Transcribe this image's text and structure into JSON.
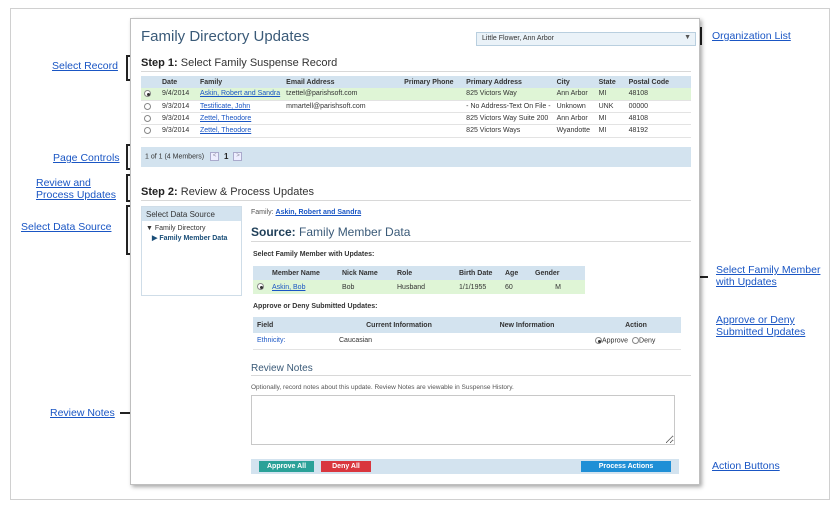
{
  "annotations": {
    "select_record": "Select Record",
    "page_controls": "Page Controls",
    "review_process_1": "Review and",
    "review_process_2": "Process Updates",
    "select_data_source": "Select Data Source",
    "review_notes": "Review Notes",
    "organization_list": "Organization List",
    "select_family_member_1": "Select Family Member",
    "select_family_member_2": "with Updates",
    "approve_deny_1": "Approve or Deny",
    "approve_deny_2": "Submitted Updates",
    "action_buttons": "Action Buttons"
  },
  "header": {
    "title": "Family Directory Updates",
    "organization_selected": "Little Flower, Ann Arbor"
  },
  "step1": {
    "label_bold": "Step 1:",
    "label_rest": " Select Family Suspense Record",
    "columns": [
      "Date",
      "Family",
      "Email Address",
      "Primary Phone",
      "Primary Address",
      "City",
      "State",
      "Postal Code"
    ],
    "rows": [
      {
        "date": "9/4/2014",
        "family": "Askin, Robert and Sandra",
        "email": "tzettel@parishsoft.com",
        "phone": "",
        "address": "825 Victors Way",
        "city": "Ann Arbor",
        "state": "MI",
        "postal": "48108"
      },
      {
        "date": "9/3/2014",
        "family": "Testificate, John",
        "email": "mmartell@parishsoft.com",
        "phone": "",
        "address": "- No Address-Text On File -",
        "city": "Unknown",
        "state": "UNK",
        "postal": "00000"
      },
      {
        "date": "9/3/2014",
        "family": "Zettel, Theodore",
        "email": "",
        "phone": "",
        "address": "825 Victors Way Suite 200",
        "city": "Ann Arbor",
        "state": "MI",
        "postal": "48108"
      },
      {
        "date": "9/3/2014",
        "family": "Zettel, Theodore",
        "email": "",
        "phone": "",
        "address": "825 Victors Ways",
        "city": "Wyandotte",
        "state": "MI",
        "postal": "48192"
      }
    ],
    "pager_text": "1 of 1 (4 Members)",
    "pager_prev": "<",
    "pager_page": "1",
    "pager_next": ">"
  },
  "step2": {
    "label_bold": "Step 2:",
    "label_rest": " Review & Process Updates",
    "data_source_header": "Select Data Source",
    "data_source_items": [
      "Family Directory",
      "Family Member Data"
    ],
    "family_label": "Family:",
    "family_name": "Askin, Robert and Sandra",
    "source_bold": "Source:",
    "source_rest": " Family Member Data",
    "select_member_label": "Select Family Member with Updates:",
    "member_columns": [
      "Member Name",
      "Nick Name",
      "Role",
      "Birth Date",
      "Age",
      "Gender"
    ],
    "member_row": {
      "name": "Askin, Bob",
      "nick": "Bob",
      "role": "Husband",
      "birth": "1/1/1955",
      "age": "60",
      "gender": "M"
    },
    "approve_label": "Approve or Deny Submitted Updates:",
    "update_columns": [
      "Field",
      "Current Information",
      "New Information",
      "Action"
    ],
    "update_row": {
      "field": "Ethnicity:",
      "current": "Caucasian",
      "new": "",
      "approve": "Approve",
      "deny": "Deny"
    },
    "review_notes_title": "Review Notes",
    "review_notes_desc": "Optionally, record notes about this update. Review Notes are viewable in Suspense History.",
    "approve_all": "Approve All",
    "deny_all": "Deny All",
    "process_actions": "Process Actions"
  },
  "colors": {
    "accent": "#3a5a78",
    "header_bg": "#d3e3ef",
    "selected_row": "#dff5d6",
    "approve_btn": "#2aa198",
    "deny_btn": "#d9363e",
    "process_btn": "#1f8fd6",
    "link": "#1a56c4"
  }
}
